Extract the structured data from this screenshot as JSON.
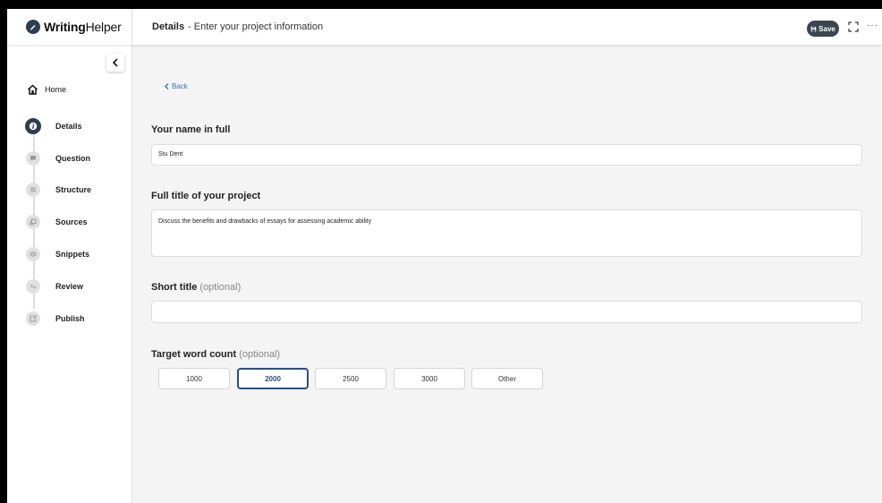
{
  "app": {
    "logo_bold": "Writing",
    "logo_light": "Helper"
  },
  "header": {
    "title": "Details",
    "subtitle": "- Enter your project information",
    "save_label": "Save"
  },
  "sidebar": {
    "home_label": "Home",
    "steps": [
      {
        "label": "Details",
        "icon": "info-icon",
        "active": true
      },
      {
        "label": "Question",
        "icon": "speech-bubble-icon"
      },
      {
        "label": "Structure",
        "icon": "list-icon"
      },
      {
        "label": "Sources",
        "icon": "copy-icon"
      },
      {
        "label": "Snippets",
        "icon": "quote-icon"
      },
      {
        "label": "Review",
        "icon": "review-check-icon"
      },
      {
        "label": "Publish",
        "icon": "external-link-icon"
      }
    ]
  },
  "main": {
    "back_label": "Back",
    "name_label": "Your name in full",
    "name_value": "Stu Dent",
    "title_label": "Full title of your project",
    "title_value": "Discuss the benefits and drawbacks of essays for assessing academic ability",
    "short_title_label": "Short title",
    "short_title_optional": "(optional)",
    "short_title_value": "",
    "word_count_label": "Target word count",
    "word_count_optional": "(optional)",
    "word_count_options": [
      "1000",
      "2000",
      "2500",
      "3000",
      "Other"
    ],
    "word_count_selected": "2000"
  },
  "colors": {
    "brand_dark": "#2c3e50",
    "link": "#3b6fb6",
    "selected_border": "#2d4f7c",
    "background": "#f4f4f4"
  }
}
